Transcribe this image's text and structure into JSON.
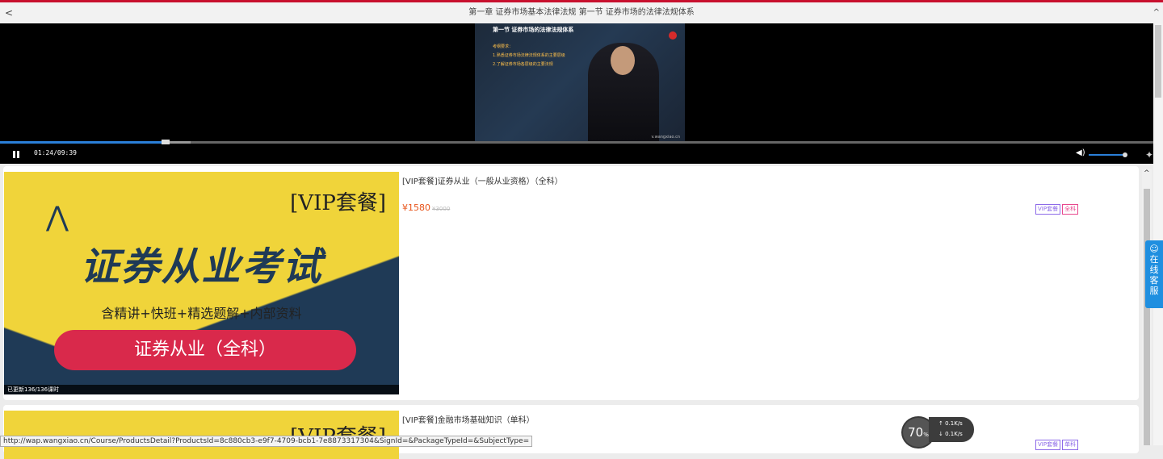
{
  "header": {
    "back": "<",
    "title": "第一章 证券市场基本法律法规 第一节 证券市场的法律法规体系",
    "collapse": "^"
  },
  "video": {
    "slide_title": "第一节 证券市场的法律法规体系",
    "slide_lines": [
      "考纲要求：",
      "1.熟悉证券市场法律法规体系的主要层级",
      "2.了解证券市场各层级的主要法规"
    ],
    "watermark": "v.wangxiao.cn",
    "time": "01:24/09:39",
    "progress": 0.14,
    "buffered_end": 0.165,
    "volume": 0.95
  },
  "courses": [
    {
      "title": "[VIP套餐]证券从业（一般从业资格）（全科）",
      "price": "¥1580",
      "orig_price": "¥3000",
      "tags": [
        "VIP套餐",
        "全科"
      ],
      "image": {
        "vip": "[VIP套餐]",
        "big": "证券从业考试",
        "sub": "含精讲+快班+精选题解+内部资料",
        "pill": "证券从业（全科）",
        "updated": "已更新136/136课时"
      }
    },
    {
      "title": "[VIP套餐]金融市场基础知识（单科）",
      "tags": [
        "VIP套餐",
        "单科"
      ],
      "image": {
        "vip": "[VIP套餐]"
      }
    }
  ],
  "chat": {
    "label": "在线客服"
  },
  "status_url": "http://wap.wangxiao.cn/Course/ProductsDetail?ProductsId=8c880cb3-e9f7-4709-bcb1-7e8873317304&SignId=&PackageTypeId=&SubjectType=",
  "speed": {
    "percent": "70",
    "unit": "%",
    "up": "0.1",
    "down": "0.1",
    "rate_unit": "K/s"
  },
  "colors": {
    "accent": "#c8102e",
    "price": "#e8541a",
    "progress": "#2a7fd8",
    "chat": "#1f8fe0"
  }
}
